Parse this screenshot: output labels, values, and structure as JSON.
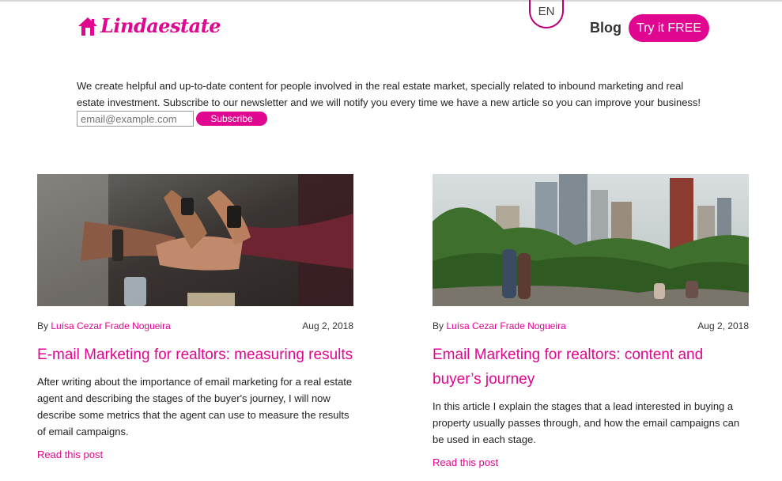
{
  "header": {
    "brand": "Lindaestate",
    "lang": "EN",
    "nav_blog": "Blog",
    "cta": "Try it FREE"
  },
  "newsletter": {
    "intro": "We create helpful and up-to-date content for people involved in the real estate market, specially related to inbound marketing and real estate investment. Subscribe to our newsletter and we will notify you every time we have a new article so you can improve your business!",
    "placeholder": "email@example.com",
    "button": "Subscribe"
  },
  "posts": [
    {
      "by": "By",
      "author": "Luísa Cezar Frade Nogueira",
      "date": "Aug 2, 2018",
      "title": "E-mail Marketing for realtors: measuring results",
      "excerpt": "After writing about the importance of email marketing for a real estate agent and describing the stages of the buyer's journey, I will now describe some metrics that the agent can use to measure the results of email campaigns.",
      "read_more": "Read this post"
    },
    {
      "by": "By",
      "author": "Luísa Cezar Frade Nogueira",
      "date": "Aug 2, 2018",
      "title": "Email Marketing for realtors: content and buyer’s journey",
      "excerpt": "In this article I explain the stages that a lead interested in buying a property usually passes through, and how the email campaigns can be used in each stage.",
      "read_more": "Read this post"
    }
  ],
  "colors": {
    "accent": "#e0068f",
    "text": "#222222"
  },
  "icons": {
    "logo": "house-icon"
  }
}
